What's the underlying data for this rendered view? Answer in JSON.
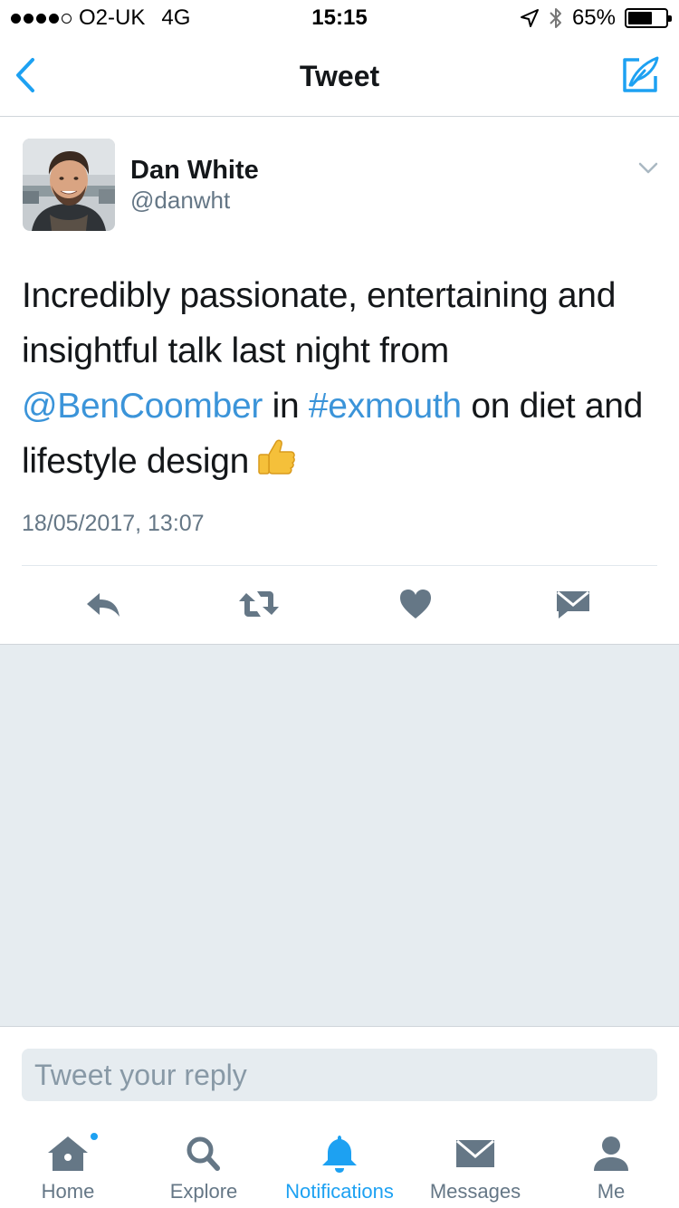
{
  "status_bar": {
    "carrier": "O2-UK",
    "network": "4G",
    "time": "15:15",
    "battery": "65%",
    "battery_level": 0.65
  },
  "nav": {
    "title": "Tweet",
    "back_icon": "chevron-left-icon",
    "compose_icon": "compose-tweet-icon"
  },
  "tweet": {
    "author_name": "Dan White",
    "author_handle": "@danwht",
    "text_part1": "Incredibly passionate, entertaining and insightful talk last night from ",
    "mention": "@BenCoomber",
    "text_part2": " in ",
    "hashtag": "#exmouth",
    "text_part3": " on diet and lifestyle design",
    "emoji": "thumbs-up",
    "timestamp": "18/05/2017, 13:07"
  },
  "actions": [
    "reply-icon",
    "retweet-icon",
    "like-icon",
    "direct-message-icon"
  ],
  "reply": {
    "placeholder": "Tweet your reply"
  },
  "tabs": [
    {
      "label": "Home",
      "icon": "home-icon",
      "active": false
    },
    {
      "label": "Explore",
      "icon": "search-icon",
      "active": false
    },
    {
      "label": "Notifications",
      "icon": "bell-icon",
      "active": true
    },
    {
      "label": "Messages",
      "icon": "envelope-icon",
      "active": false
    },
    {
      "label": "Me",
      "icon": "person-icon",
      "active": false
    }
  ],
  "colors": {
    "accent": "#1da1f2",
    "link": "#3b94d9",
    "icon_gray": "#657786",
    "background_gray": "#e6ecf0"
  }
}
